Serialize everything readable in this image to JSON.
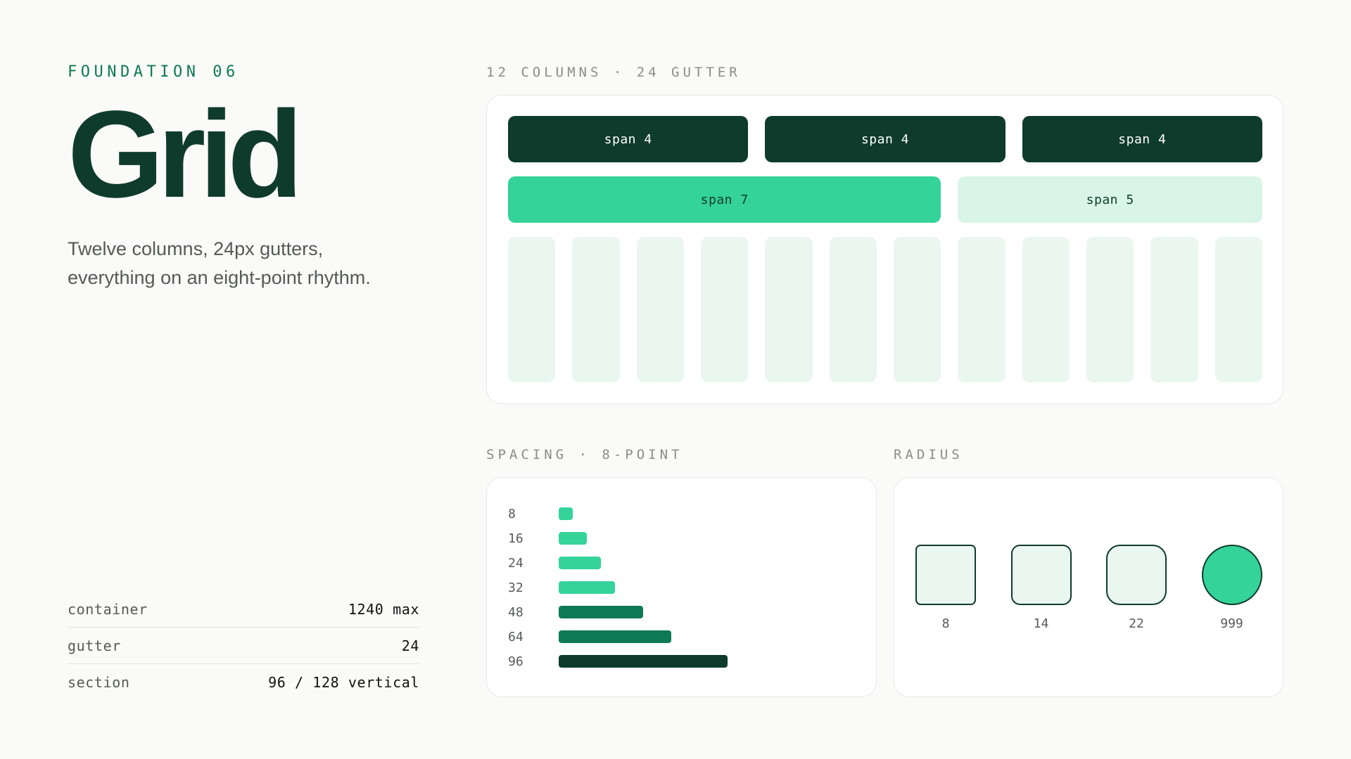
{
  "header": {
    "eyebrow": "FOUNDATION 06",
    "title": "Grid",
    "description": "Twelve columns, 24px gutters, everything on an eight-point rhythm."
  },
  "specs": [
    {
      "label": "container",
      "value": "1240 max"
    },
    {
      "label": "gutter",
      "value": "24"
    },
    {
      "label": "section",
      "value": "96 / 128 vertical"
    }
  ],
  "grid": {
    "section_label": "12 COLUMNS · 24 GUTTER",
    "columns": 12,
    "row1": [
      {
        "label": "span 4",
        "span": 4,
        "color": "#0f3b2c"
      },
      {
        "label": "span 4",
        "span": 4,
        "color": "#0f3b2c"
      },
      {
        "label": "span 4",
        "span": 4,
        "color": "#0f3b2c"
      }
    ],
    "row2": [
      {
        "label": "span 7",
        "span": 7,
        "color": "#34d399"
      },
      {
        "label": "span 5",
        "span": 5,
        "color": "#d8f5e8"
      }
    ]
  },
  "spacing": {
    "section_label": "SPACING · 8-POINT",
    "steps": [
      {
        "value": "8",
        "color": "#34d399"
      },
      {
        "value": "16",
        "color": "#34d399"
      },
      {
        "value": "24",
        "color": "#34d399"
      },
      {
        "value": "32",
        "color": "#34d399"
      },
      {
        "value": "48",
        "color": "#0e7a55"
      },
      {
        "value": "64",
        "color": "#0e7a55"
      },
      {
        "value": "96",
        "color": "#0f3b2c"
      }
    ]
  },
  "radius": {
    "section_label": "RADIUS",
    "items": [
      {
        "value": "8",
        "fill": "#eaf7f0"
      },
      {
        "value": "14",
        "fill": "#eaf7f0"
      },
      {
        "value": "22",
        "fill": "#eaf7f0"
      },
      {
        "value": "999",
        "fill": "#34d399"
      }
    ]
  },
  "colors": {
    "forest": "#0f3b2c",
    "emerald": "#0e7a55",
    "mint": "#34d399",
    "mint_light": "#d8f5e8",
    "column_tint": "#eaf7f0"
  }
}
